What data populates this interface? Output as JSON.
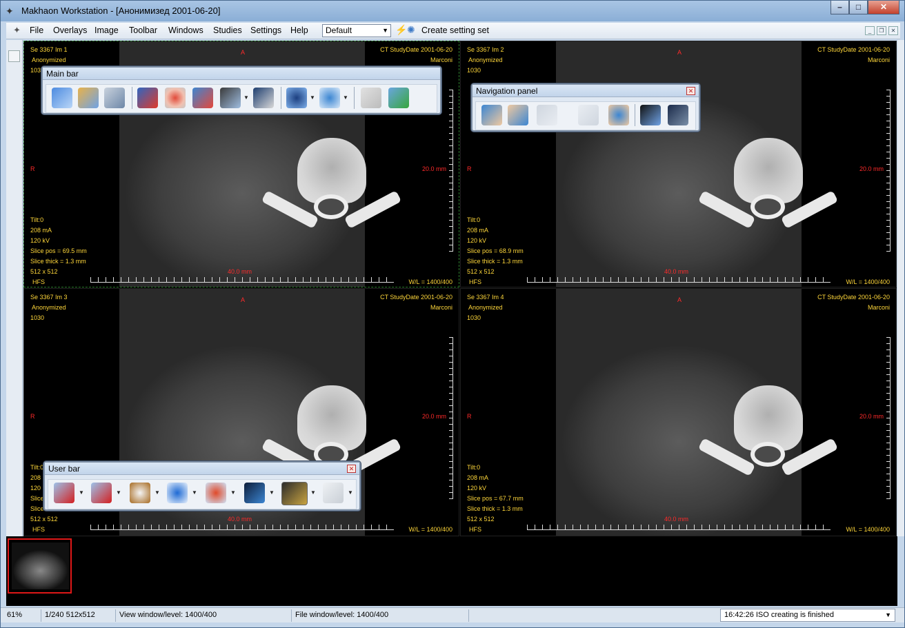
{
  "window": {
    "title": "Makhaon Workstation - [Анонимизед  2001-06-20]"
  },
  "menu": {
    "items": [
      "File",
      "Overlays",
      "Image",
      "Toolbar",
      "Windows",
      "Studies",
      "Settings",
      "Help"
    ],
    "preset": "Default",
    "create_setting": "Create setting set"
  },
  "toolbars": {
    "main": {
      "title": "Main bar"
    },
    "nav": {
      "title": "Navigation panel"
    },
    "user": {
      "title": "User bar"
    }
  },
  "panes": [
    {
      "series": "Se 3367  Im 1",
      "patient": "Anonymized",
      "id": "1030",
      "study": "CT StudyDate 2001-06-20",
      "physician": "Marconi",
      "orient_top": "A",
      "orient_left": "R",
      "scale_right": "20.0 mm",
      "scale_bottom": "40.0 mm",
      "tilt": "Tilt:0",
      "ma": "208 mA",
      "kv": "120 kV",
      "slice_pos": "Slice pos = 69.5 mm",
      "slice_thick": "Slice thick = 1.3 mm",
      "matrix": "512 x 512",
      "position": "HFS",
      "wl": "W/L = 1400/400"
    },
    {
      "series": "Se 3367  Im 2",
      "patient": "Anonymized",
      "id": "1030",
      "study": "CT StudyDate 2001-06-20",
      "physician": "Marconi",
      "orient_top": "A",
      "orient_left": "R",
      "scale_right": "20.0 mm",
      "scale_bottom": "40.0 mm",
      "tilt": "Tilt:0",
      "ma": "208 mA",
      "kv": "120 kV",
      "slice_pos": "Slice pos = 68.9 mm",
      "slice_thick": "Slice thick = 1.3 mm",
      "matrix": "512 x 512",
      "position": "HFS",
      "wl": "W/L = 1400/400"
    },
    {
      "series": "Se 3367  Im 3",
      "patient": "Anonymized",
      "id": "1030",
      "study": "CT StudyDate 2001-06-20",
      "physician": "Marconi",
      "orient_top": "A",
      "orient_left": "R",
      "scale_right": "20.0 mm",
      "scale_bottom": "40.0 mm",
      "tilt": "Tilt:0",
      "ma": "208",
      "kv": "120",
      "slice_pos": "Slice",
      "slice_thick": "Slice",
      "matrix": "512 x 512",
      "position": "HFS",
      "wl": "W/L = 1400/400"
    },
    {
      "series": "Se 3367  Im 4",
      "patient": "Anonymized",
      "id": "1030",
      "study": "CT StudyDate 2001-06-20",
      "physician": "Marconi",
      "orient_top": "A",
      "orient_left": "R",
      "scale_right": "20.0 mm",
      "scale_bottom": "40.0 mm",
      "tilt": "Tilt:0",
      "ma": "208 mA",
      "kv": "120 kV",
      "slice_pos": "Slice pos = 67.7 mm",
      "slice_thick": "Slice thick = 1.3 mm",
      "matrix": "512 x 512",
      "position": "HFS",
      "wl": "W/L = 1400/400"
    }
  ],
  "status": {
    "zoom": "61%",
    "frame": "1/240 512x512",
    "view_wl": "View window/level: 1400/400",
    "file_wl": "File window/level: 1400/400",
    "message": "16:42:26 ISO creating is finished"
  },
  "colors": {
    "overlay_text": "#ffd73a",
    "overlay_marker": "#ff2a2a",
    "active_border": "#2d7d2d",
    "thumb_selected": "#e01818"
  }
}
